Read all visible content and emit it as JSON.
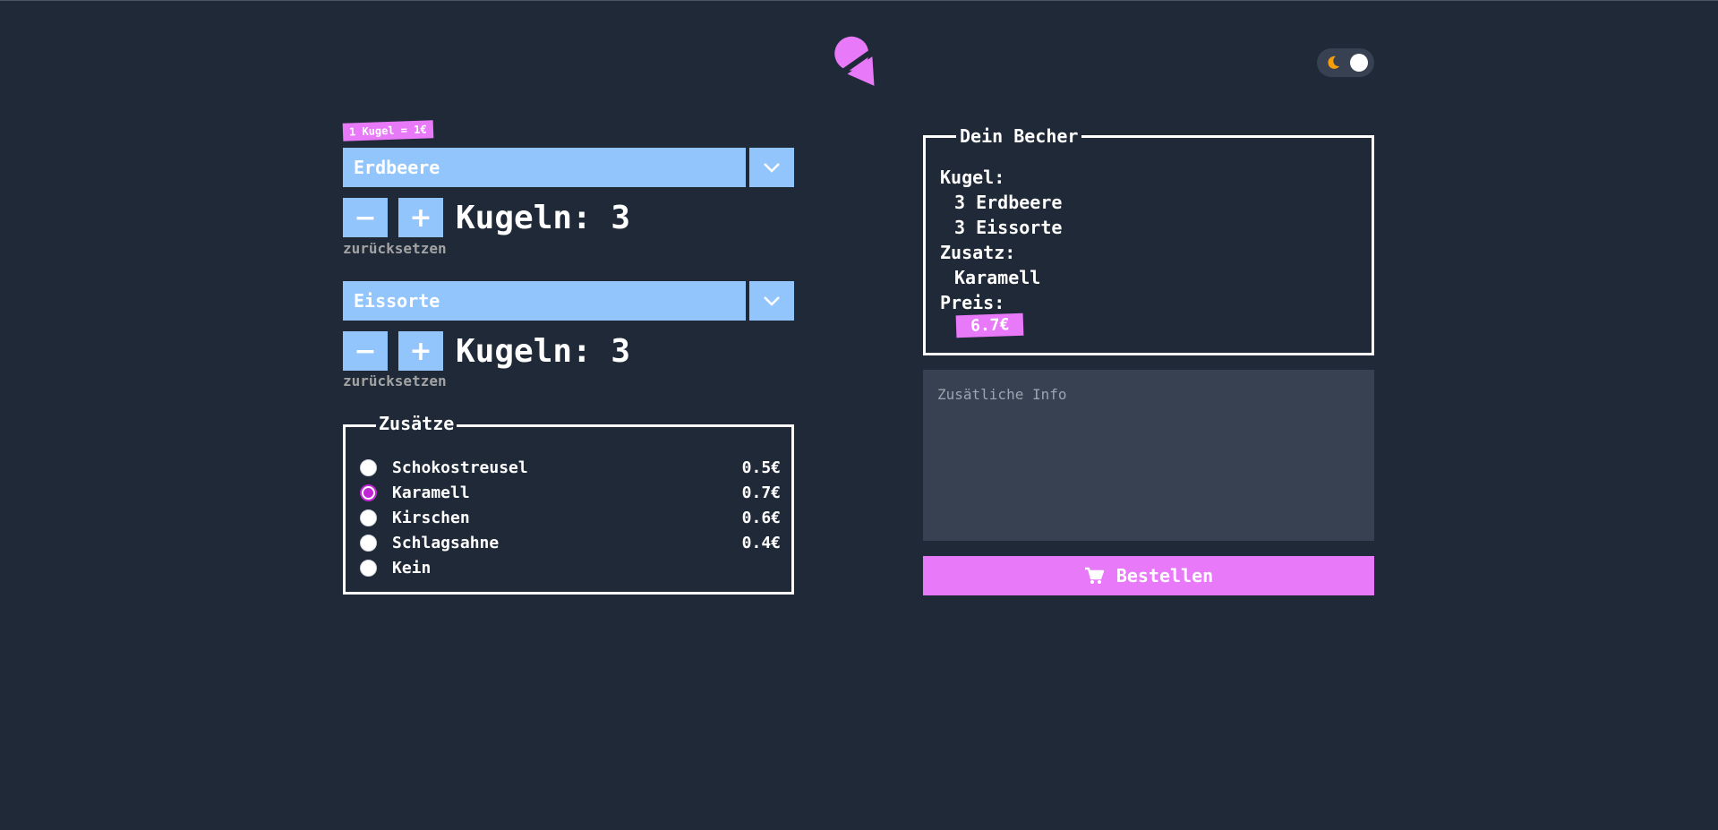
{
  "price_note": "1 Kugel = 1€",
  "flavors": [
    {
      "selected": "Erdbeere",
      "scoops_label": "Kugeln: 3",
      "reset_label": "zurücksetzen"
    },
    {
      "selected": "Eissorte",
      "scoops_label": "Kugeln: 3",
      "reset_label": "zurücksetzen"
    }
  ],
  "buttons": {
    "minus": "−",
    "plus": "+"
  },
  "extras": {
    "title": "Zusätze",
    "options": [
      {
        "name": "Schokostreusel",
        "price": "0.5€",
        "checked": false
      },
      {
        "name": "Karamell",
        "price": "0.7€",
        "checked": true
      },
      {
        "name": "Kirschen",
        "price": "0.6€",
        "checked": false
      },
      {
        "name": "Schlagsahne",
        "price": "0.4€",
        "checked": false
      },
      {
        "name": "Kein",
        "price": "",
        "checked": false
      }
    ]
  },
  "cup": {
    "title": "Dein Becher",
    "kugel_label": "Kugel:",
    "kugel_items": [
      "3 Erdbeere",
      "3 Eissorte"
    ],
    "zusatz_label": "Zusatz:",
    "zusatz_value": "Karamell",
    "preis_label": "Preis:",
    "preis_value": "6.7€"
  },
  "info": {
    "placeholder": "Zusätliche Info"
  },
  "order": {
    "label": "Bestellen"
  },
  "colors": {
    "background": "#1f2937",
    "accent": "#e879f9",
    "select": "#93c5fd",
    "panel": "#374151"
  },
  "icons": [
    "ice-cream-logo-icon",
    "moon-icon",
    "chevron-down-icon",
    "cart-icon"
  ]
}
